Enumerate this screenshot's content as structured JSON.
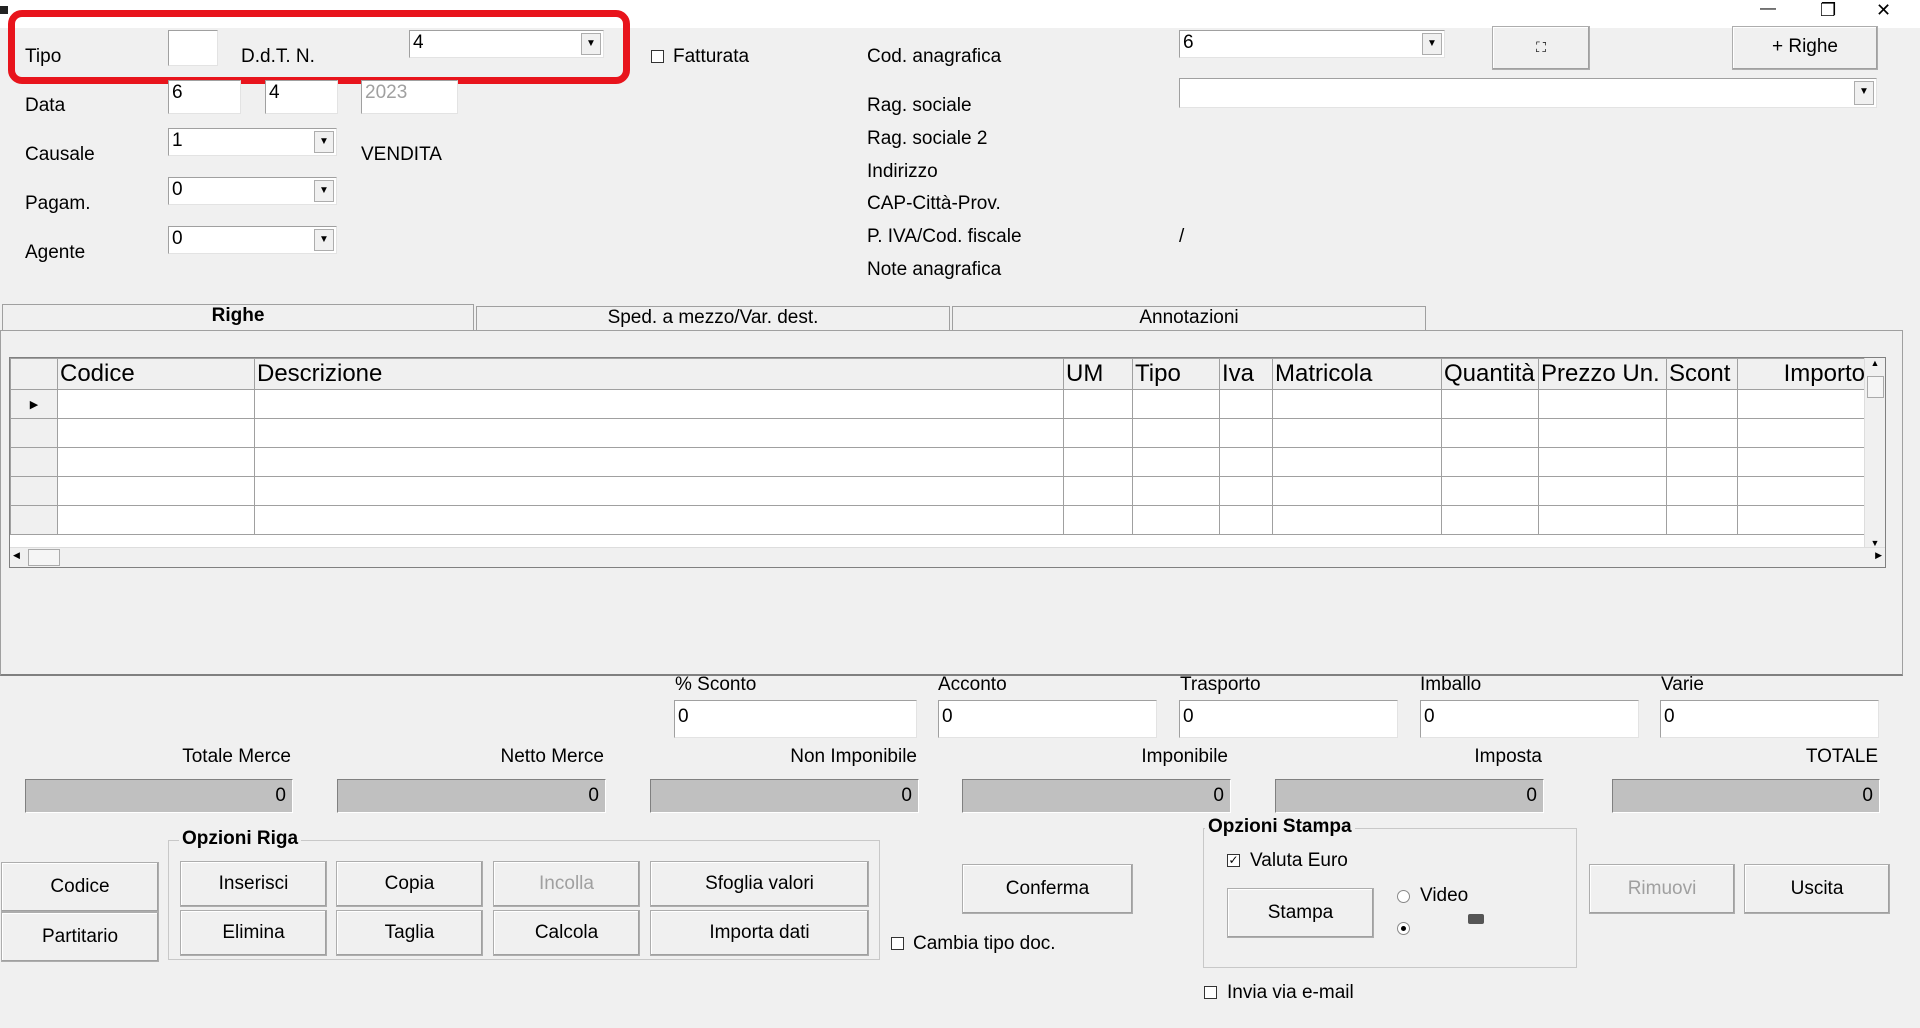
{
  "window": {
    "min": "—",
    "restore": "❐",
    "close": "✕"
  },
  "header": {
    "tipo_label": "Tipo",
    "tipo_value": "",
    "ddt_label": "D.d.T. N.",
    "ddt_value": "4",
    "data_label": "Data",
    "data_day": "6",
    "data_month": "4",
    "data_year": "2023",
    "causale_label": "Causale",
    "causale_value": "1",
    "causale_text": "VENDITA",
    "pagam_label": "Pagam.",
    "pagam_value": "0",
    "agente_label": "Agente",
    "agente_value": "0",
    "fatturata_label": "Fatturata",
    "cod_anag_label": "Cod. anagrafica",
    "cod_anag_value": "6",
    "rag_sociale_label": "Rag. sociale",
    "rag_sociale_value": "",
    "rag_sociale2_label": "Rag. sociale 2",
    "indirizzo_label": "Indirizzo",
    "cap_label": "CAP-Città-Prov.",
    "piva_label": "P. IVA/Cod. fiscale",
    "piva_value": "/",
    "note_label": "Note anagrafica",
    "righe_button": "+ Righe"
  },
  "tabs": [
    "Righe",
    "Sped. a mezzo/Var. dest.",
    "Annotazioni"
  ],
  "grid": {
    "columns": [
      "Codice",
      "Descrizione",
      "UM",
      "Tipo",
      "Iva",
      "Matricola",
      "Quantità",
      "Prezzo Un.",
      "Scont",
      "Importo"
    ],
    "row_marker": "▶"
  },
  "extras": [
    {
      "label": "% Sconto",
      "value": "0"
    },
    {
      "label": "Acconto",
      "value": "0"
    },
    {
      "label": "Trasporto",
      "value": "0"
    },
    {
      "label": "Imballo",
      "value": "0"
    },
    {
      "label": "Varie",
      "value": "0"
    }
  ],
  "totals": [
    {
      "label": "Totale Merce",
      "value": "0"
    },
    {
      "label": "Netto Merce",
      "value": "0"
    },
    {
      "label": "Non Imponibile",
      "value": "0"
    },
    {
      "label": "Imponibile",
      "value": "0"
    },
    {
      "label": "Imposta",
      "value": "0"
    },
    {
      "label": "TOTALE",
      "value": "0"
    }
  ],
  "left_buttons": {
    "codice": "Codice",
    "partitario": "Partitario"
  },
  "opzioni_riga": {
    "title": "Opzioni Riga",
    "inserisci": "Inserisci",
    "copia": "Copia",
    "incolla": "Incolla",
    "sfoglia": "Sfoglia valori",
    "elimina": "Elimina",
    "taglia": "Taglia",
    "calcola": "Calcola",
    "importa": "Importa dati"
  },
  "conferma": "Conferma",
  "cambia_tipo": "Cambia tipo doc.",
  "opzioni_stampa": {
    "title": "Opzioni Stampa",
    "valuta": "Valuta Euro",
    "stampa": "Stampa",
    "video": "Video"
  },
  "invia_email": "Invia via e-mail",
  "rimuovi": "Rimuovi",
  "uscita": "Uscita",
  "highlight_color": "#e8141c"
}
